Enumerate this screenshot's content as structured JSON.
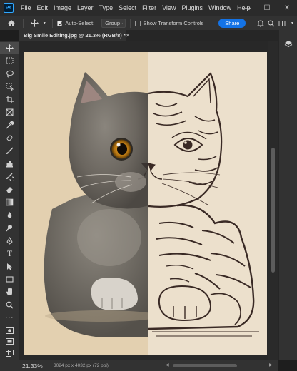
{
  "app": {
    "logo": "Ps"
  },
  "menu": [
    "File",
    "Edit",
    "Image",
    "Layer",
    "Type",
    "Select",
    "Filter",
    "View",
    "Plugins",
    "Window",
    "Help"
  ],
  "window_controls": {
    "minimize": "—",
    "maximize": "☐",
    "close": "✕"
  },
  "options": {
    "auto_select_label": "Auto-Select:",
    "auto_select_checked": true,
    "auto_select_target": "Group",
    "transform_controls_label": "Show Transform Controls",
    "transform_controls_checked": false,
    "share_label": "Share"
  },
  "document_tab": {
    "title": "Big Smile Editing.jpg @ 21.3% (RGB/8) *"
  },
  "document_image": {
    "description_left": "photographic grey cat",
    "description_right": "engraving-style line art of the same cat",
    "left_bg": "#e3d0b0",
    "right_bg": "#ece0cc"
  },
  "status": {
    "zoom": "21.33%",
    "doc_info": "3024 px x 4032 px (72 ppi)"
  },
  "tools": [
    "move-tool",
    "artboard-tool",
    "lasso-tool",
    "object-select-tool",
    "crop-tool",
    "frame-tool",
    "eyedropper-tool",
    "spot-healing-tool",
    "brush-tool",
    "clone-stamp-tool",
    "history-brush-tool",
    "eraser-tool",
    "gradient-tool",
    "blur-tool",
    "dodge-tool",
    "pen-tool",
    "type-tool",
    "path-select-tool",
    "rectangle-tool",
    "hand-tool",
    "zoom-tool",
    "more-tools"
  ],
  "colors": {
    "foreground": "#000000",
    "background": "#ffffff",
    "accent": "#1473e6"
  }
}
